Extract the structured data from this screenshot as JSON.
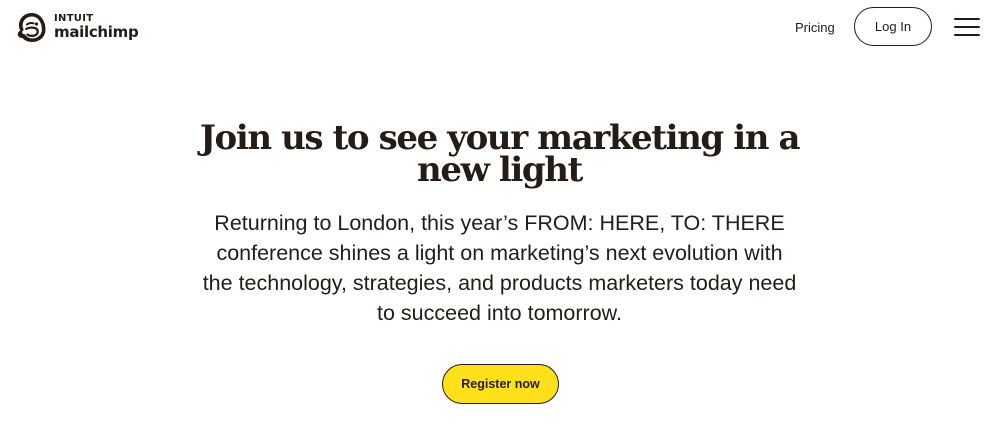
{
  "header": {
    "logo": {
      "brand_top": "INTUIT",
      "brand_bottom": "mailchimp",
      "icon": "freddie-chimp-icon"
    },
    "nav": {
      "pricing_label": "Pricing",
      "login_label": "Log In",
      "menu_icon": "hamburger-menu-icon"
    }
  },
  "hero": {
    "title": "Join us to see your marketing in a new light",
    "body": "Returning to London, this year’s FROM: HERE, TO: THERE conference shines a light on marketing’s next evolution with the technology, strategies, and products marketers today need to succeed into tomorrow.",
    "cta_label": "Register now"
  },
  "colors": {
    "text": "#241c15",
    "cta_background": "#ffe01b",
    "background": "#ffffff"
  }
}
